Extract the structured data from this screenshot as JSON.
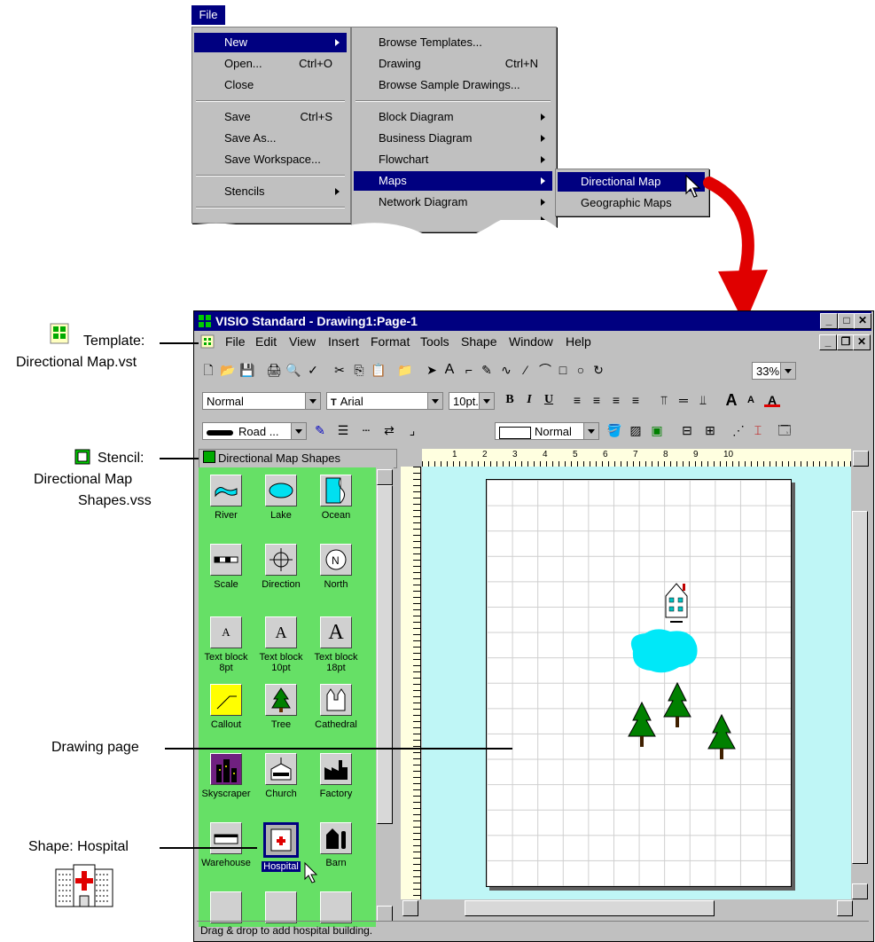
{
  "file_menu": {
    "title": "File",
    "items": [
      {
        "label": "New",
        "shortcut": "",
        "submenu": true
      },
      {
        "label": "Open...",
        "shortcut": "Ctrl+O"
      },
      {
        "label": "Close",
        "shortcut": ""
      },
      {
        "label": "Save",
        "shortcut": "Ctrl+S"
      },
      {
        "label": "Save As...",
        "shortcut": ""
      },
      {
        "label": "Save Workspace...",
        "shortcut": ""
      },
      {
        "label": "Stencils",
        "shortcut": "",
        "submenu": true
      }
    ]
  },
  "new_menu": {
    "items": [
      {
        "label": "Browse Templates...",
        "shortcut": ""
      },
      {
        "label": "Drawing",
        "shortcut": "Ctrl+N"
      },
      {
        "label": "Browse Sample Drawings...",
        "shortcut": ""
      },
      {
        "label": "Block Diagram"
      },
      {
        "label": "Business Diagram"
      },
      {
        "label": "Flowchart"
      },
      {
        "label": "Maps"
      },
      {
        "label": "Network Diagram"
      }
    ]
  },
  "maps_menu": {
    "items": [
      {
        "label": "Directional Map"
      },
      {
        "label": "Geographic Maps"
      }
    ]
  },
  "window": {
    "title": "VISIO Standard - Drawing1:Page-1",
    "menubar": [
      "File",
      "Edit",
      "View",
      "Insert",
      "Format",
      "Tools",
      "Shape",
      "Window",
      "Help"
    ],
    "style_combo": "Normal",
    "font_combo": "Arial",
    "size_combo": "10pt.",
    "zoom_combo": "33%",
    "line_combo": "Road ...",
    "fill_combo": "Normal",
    "status_text": "Drag & drop to add hospital building."
  },
  "stencil": {
    "title": "Directional Map Shapes",
    "shapes": [
      {
        "label": "River",
        "icon": "river-icon"
      },
      {
        "label": "Lake",
        "icon": "lake-icon"
      },
      {
        "label": "Ocean",
        "icon": "ocean-icon"
      },
      {
        "label": "Scale",
        "icon": "scale-icon"
      },
      {
        "label": "Direction",
        "icon": "direction-icon"
      },
      {
        "label": "North",
        "icon": "north-icon"
      },
      {
        "label": "Text block 8pt",
        "icon": "text-icon"
      },
      {
        "label": "Text block 10pt",
        "icon": "text-icon"
      },
      {
        "label": "Text block 18pt",
        "icon": "text-icon"
      },
      {
        "label": "Callout",
        "icon": "callout-icon"
      },
      {
        "label": "Tree",
        "icon": "tree-icon"
      },
      {
        "label": "Cathedral",
        "icon": "cathedral-icon"
      },
      {
        "label": "Skyscraper",
        "icon": "skyscraper-icon"
      },
      {
        "label": "Church",
        "icon": "church-icon"
      },
      {
        "label": "Factory",
        "icon": "factory-icon"
      },
      {
        "label": "Warehouse",
        "icon": "warehouse-icon"
      },
      {
        "label": "Hospital",
        "icon": "hospital-icon"
      },
      {
        "label": "Barn",
        "icon": "barn-icon"
      }
    ]
  },
  "ruler_numbers": [
    "1",
    "2",
    "3",
    "4",
    "5",
    "6",
    "7",
    "8",
    "9",
    "10"
  ],
  "callouts": {
    "template_label": "Template:",
    "template_file": "Directional Map.vst",
    "stencil_label": "Stencil:",
    "stencil_file_1": "Directional Map",
    "stencil_file_2": "Shapes.vss",
    "drawing_page": "Drawing page",
    "shape_hospital": "Shape: Hospital"
  },
  "colors": {
    "title_bar": "#000080",
    "stencil_bg": "#66e066",
    "canvas_bg": "#bff6f6",
    "arrow": "#e00000"
  }
}
